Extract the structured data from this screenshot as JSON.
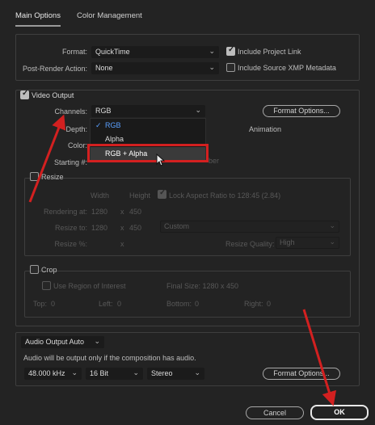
{
  "tabs": [
    {
      "label": "Main Options",
      "active": true
    },
    {
      "label": "Color Management",
      "active": false
    }
  ],
  "top": {
    "format_label": "Format:",
    "format_value": "QuickTime",
    "post_render_label": "Post-Render Action:",
    "post_render_value": "None",
    "include_project_link": {
      "label": "Include Project Link",
      "checked": true
    },
    "include_xmp": {
      "label": "Include Source XMP Metadata",
      "checked": false
    }
  },
  "video": {
    "title": "Video Output",
    "checked": true,
    "channels_label": "Channels:",
    "channels_value": "RGB",
    "depth_label": "Depth:",
    "color_label": "Color:",
    "starting_label": "Starting #:",
    "format_options_button": "Format Options...",
    "codec_text": "Animation",
    "behind_text": "ber",
    "channels_menu": {
      "items": [
        "RGB",
        "Alpha",
        "RGB + Alpha"
      ],
      "selected": "RGB",
      "hovered": "RGB + Alpha"
    }
  },
  "resize": {
    "title": "Resize",
    "checked": false,
    "width_header": "Width",
    "height_header": "Height",
    "lock_aspect": "Lock Aspect Ratio to 128:45 (2.84)",
    "rendering_at_label": "Rendering at:",
    "rendering_w": "1280",
    "rendering_h": "450",
    "resize_to_label": "Resize to:",
    "resize_to_w": "1280",
    "resize_to_h": "450",
    "times": "x",
    "preset": "Custom",
    "resize_pct_label": "Resize %:",
    "quality_label": "Resize Quality:",
    "quality_value": "High"
  },
  "crop": {
    "title": "Crop",
    "checked": false,
    "use_roi": "Use Region of Interest",
    "final_size": "Final Size: 1280 x 450",
    "top_label": "Top:",
    "top_value": "0",
    "left_label": "Left:",
    "left_value": "0",
    "bottom_label": "Bottom:",
    "bottom_value": "0",
    "right_label": "Right:",
    "right_value": "0"
  },
  "audio": {
    "mode": "Audio Output Auto",
    "note": "Audio will be output only if the composition has audio.",
    "rate": "48.000 kHz",
    "bits": "16 Bit",
    "channels": "Stereo",
    "format_options_button": "Format Options..."
  },
  "footer": {
    "cancel": "Cancel",
    "ok": "OK"
  },
  "colors": {
    "background": "#232323",
    "annotation": "#d32020",
    "selected_item": "#5aa0ff"
  }
}
